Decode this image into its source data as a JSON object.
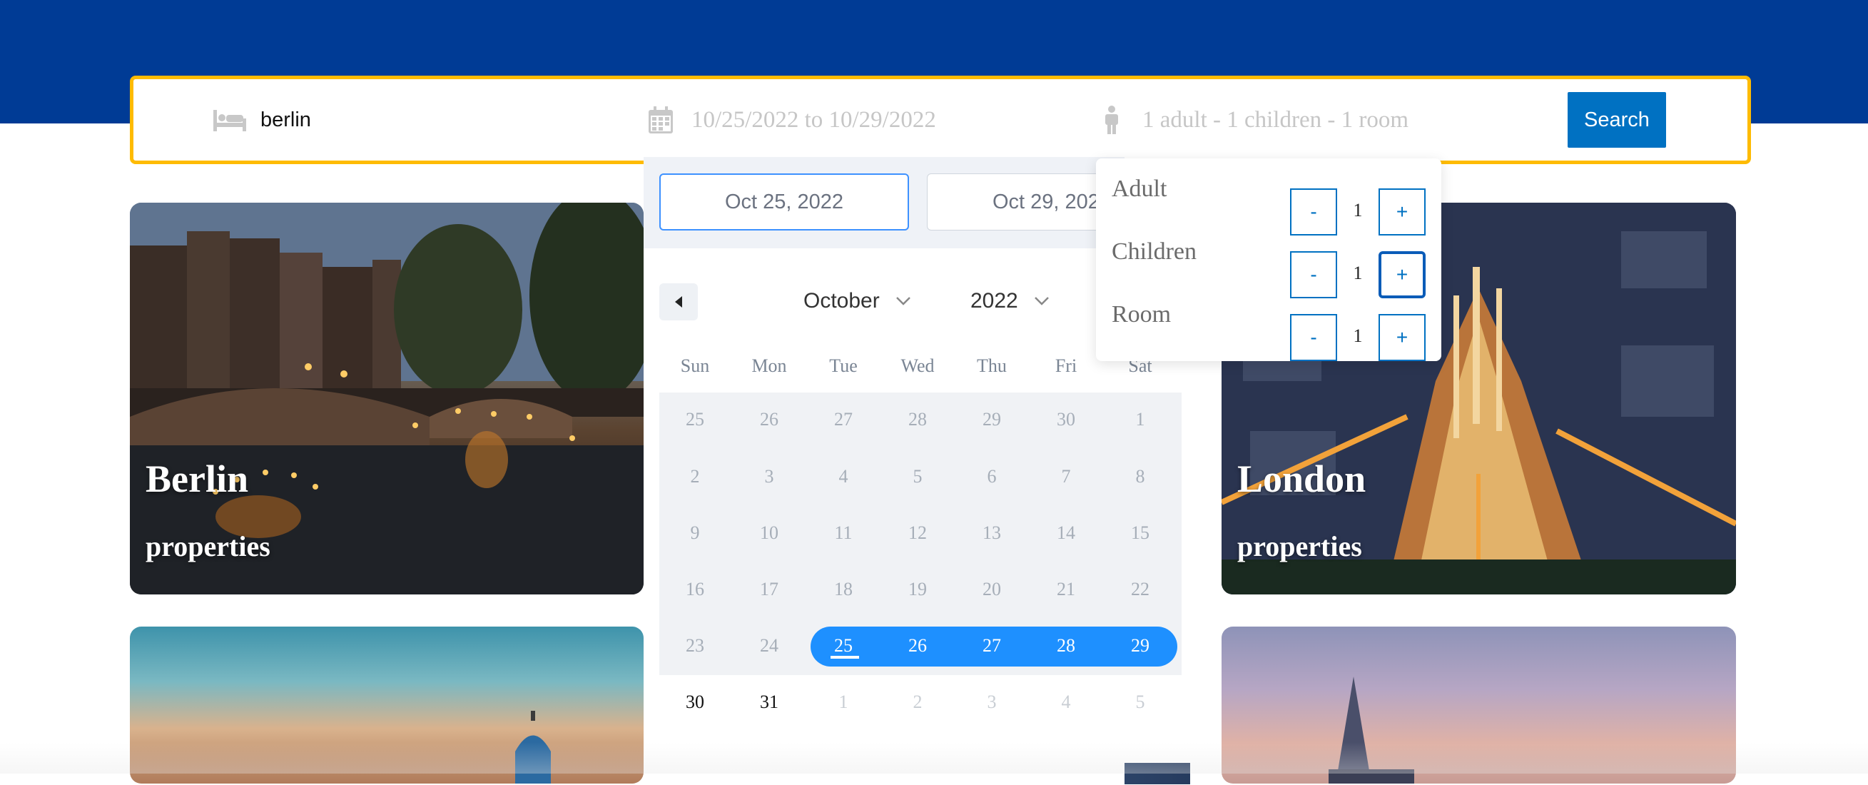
{
  "search": {
    "destination_value": "berlin",
    "dates_text": "10/25/2022 to 10/29/2022",
    "guests_text": "1 adult - 1 children - 1 room",
    "button_label": "Search",
    "icons": [
      "bed-icon",
      "calendar-icon",
      "person-icon"
    ]
  },
  "cards": [
    {
      "city": "Berlin",
      "label": "properties"
    },
    {
      "city": "London",
      "label": "properties"
    }
  ],
  "datepicker": {
    "start_date": "Oct 25, 2022",
    "end_date": "Oct 29, 2022",
    "month": "October",
    "year": "2022",
    "weekdays": [
      "Sun",
      "Mon",
      "Tue",
      "Wed",
      "Thu",
      "Fri",
      "Sat"
    ],
    "weeks": [
      [
        "25",
        "26",
        "27",
        "28",
        "29",
        "30",
        "1"
      ],
      [
        "2",
        "3",
        "4",
        "5",
        "6",
        "7",
        "8"
      ],
      [
        "9",
        "10",
        "11",
        "12",
        "13",
        "14",
        "15"
      ],
      [
        "16",
        "17",
        "18",
        "19",
        "20",
        "21",
        "22"
      ],
      [
        "23",
        "24",
        "25",
        "26",
        "27",
        "28",
        "29"
      ],
      [
        "30",
        "31",
        "1",
        "2",
        "3",
        "4",
        "5"
      ]
    ],
    "selected_range": [
      "25",
      "26",
      "27",
      "28",
      "29"
    ],
    "accent_color": "#1e90ff"
  },
  "guests": {
    "rows": [
      {
        "label": "Adult",
        "value": "1",
        "minus": "-",
        "plus": "+"
      },
      {
        "label": "Children",
        "value": "1",
        "minus": "-",
        "plus": "+"
      },
      {
        "label": "Room",
        "value": "1",
        "minus": "-",
        "plus": "+"
      }
    ]
  },
  "colors": {
    "header": "#003b95",
    "search_border": "#febb02",
    "search_button": "#0071c2"
  }
}
